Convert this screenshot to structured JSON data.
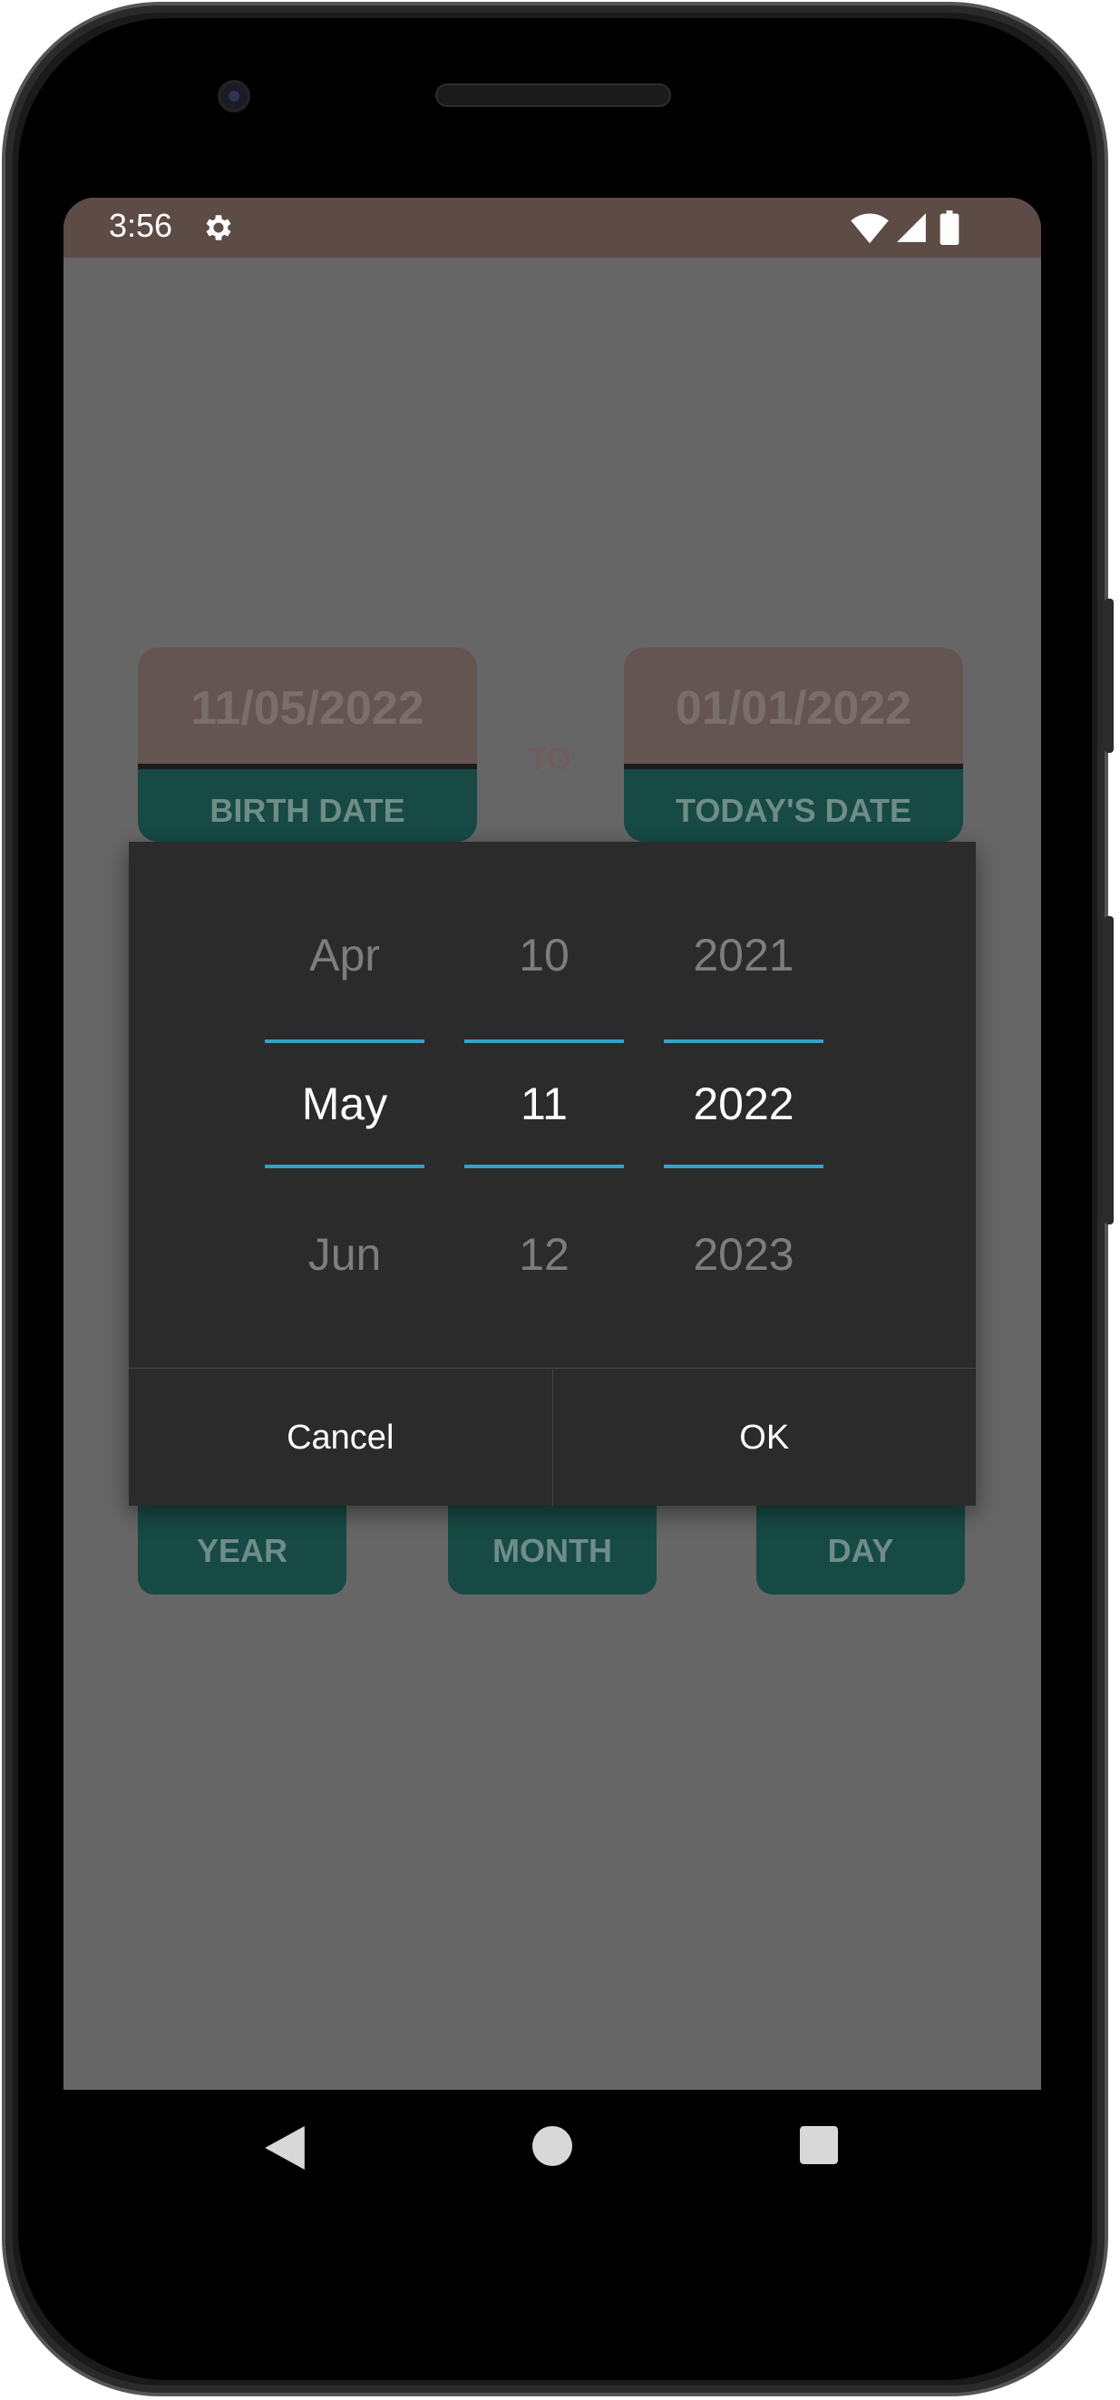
{
  "status_bar": {
    "time": "3:56"
  },
  "app": {
    "birth_date_value": "11/05/2022",
    "birth_date_label": "BIRTH DATE",
    "to_label": "TO",
    "today_date_value": "01/01/2022",
    "today_date_label": "TODAY'S DATE",
    "buttons": [
      "YEAR",
      "MONTH",
      "DAY"
    ]
  },
  "date_picker": {
    "month": {
      "prev": "Apr",
      "selected": "May",
      "next": "Jun"
    },
    "day": {
      "prev": "10",
      "selected": "11",
      "next": "12"
    },
    "year": {
      "prev": "2021",
      "selected": "2022",
      "next": "2023"
    },
    "cancel_label": "Cancel",
    "ok_label": "OK"
  },
  "colors": {
    "accent_divider": "#3a9fc9",
    "status_bar": "#5d4b46",
    "teal": "#174a44"
  },
  "icons": [
    "gear-icon",
    "wifi-icon",
    "signal-icon",
    "battery-icon",
    "back-icon",
    "home-icon",
    "recents-icon"
  ]
}
